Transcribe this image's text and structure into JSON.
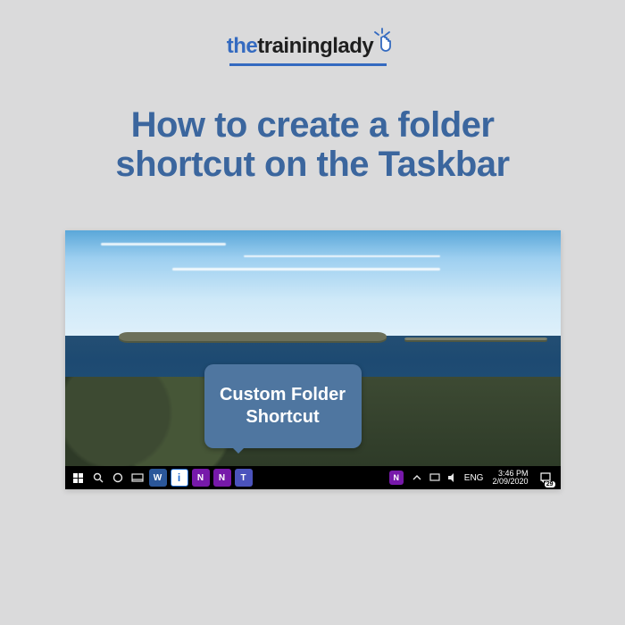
{
  "logo": {
    "the": "the",
    "training": "training",
    "lady": "lady"
  },
  "title": "How to create a folder shortcut on the Taskbar",
  "callout": "Custom Folder Shortcut",
  "taskbar": {
    "apps": {
      "word": "W",
      "info": "i",
      "onenote1": "N",
      "onenote2": "N",
      "teams": "T"
    },
    "tray": {
      "onenote": "N",
      "lang": "ENG"
    },
    "clock": {
      "time": "3:46 PM",
      "date": "2/09/2020"
    },
    "notifications": "29"
  }
}
